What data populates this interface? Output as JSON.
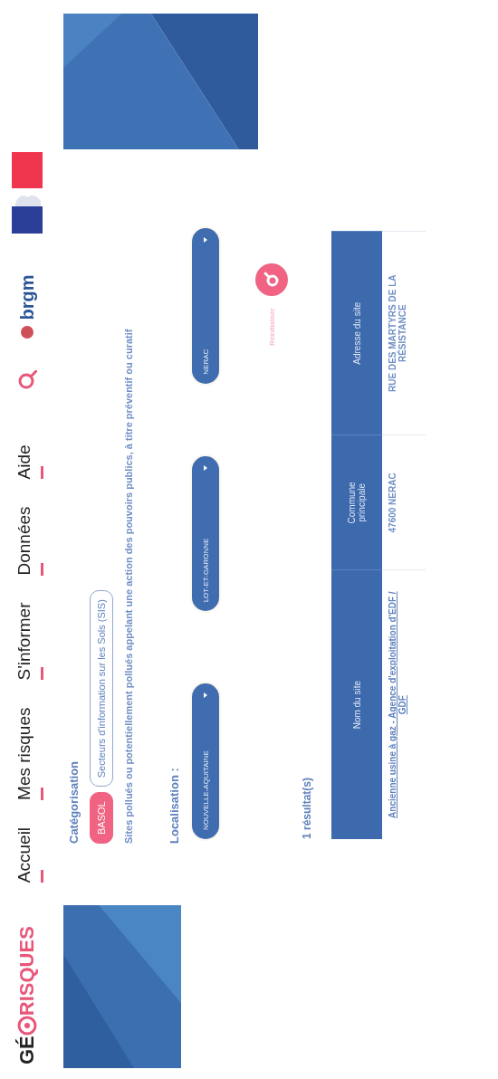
{
  "header": {
    "logo": {
      "prefix": "GÉ",
      "suffix": "RISQUES"
    },
    "nav": [
      {
        "label": "Accueil"
      },
      {
        "label": "Mes risques"
      },
      {
        "label": "S'informer"
      },
      {
        "label": "Données"
      },
      {
        "label": "Aide"
      }
    ],
    "partner_logo": "brgm"
  },
  "categorisation": {
    "label": "Catégorisation",
    "chips": [
      {
        "label": "BASOL",
        "selected": true
      },
      {
        "label": "Secteurs d'information sur les Sols (SIS)",
        "selected": false
      }
    ],
    "description": "Sites pollués ou potentiellement pollués appelant une action des pouvoirs publics, à titre préventif ou curatif"
  },
  "localisation": {
    "label": "Localisation :",
    "selects": [
      {
        "value": "NOUVELLE-AQUITAINE"
      },
      {
        "value": "LOT-ET-GARONNE"
      },
      {
        "value": "NERAC"
      }
    ]
  },
  "actions": {
    "reset": "Réinitialiser"
  },
  "results": {
    "count": "1 résultat(s)",
    "table": {
      "columns": [
        "Nom du site",
        "Commune principale",
        "Adresse du site"
      ],
      "rows": [
        {
          "site": "Ancienne usine à gaz - Agence d'exploitation d'EDF / GDF",
          "commune": "47600 NERAC",
          "adresse": "RUE DES MARTYRS DE LA RÉSISTANCE"
        }
      ]
    }
  }
}
